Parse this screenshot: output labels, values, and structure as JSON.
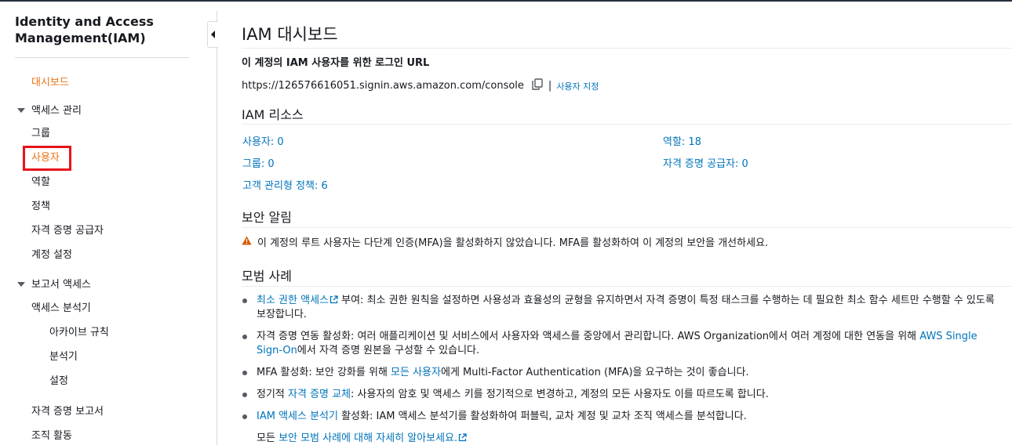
{
  "sidebar": {
    "title": "Identity and Access Management(IAM)",
    "dashboard": "대시보드",
    "access_management": {
      "label": "액세스 관리",
      "items": [
        "그룹",
        "사용자",
        "역할",
        "정책",
        "자격 증명 공급자",
        "계정 설정"
      ]
    },
    "access_reports": {
      "label": "보고서 액세스",
      "analyzer": "액세스 분석기",
      "analyzer_items": [
        "아카이브 규칙",
        "분석기",
        "설정"
      ],
      "items": [
        "자격 증명 보고서",
        "조직 활동"
      ]
    },
    "active_item": "대시보드",
    "highlighted_item": "사용자"
  },
  "main": {
    "title": "IAM 대시보드",
    "signin": {
      "label": "이 계정의 IAM 사용자를 위한 로그인 URL",
      "url": "https://126576616051.signin.aws.amazon.com/console",
      "separator": "|",
      "customize_link": "사용자 지정"
    },
    "resources": {
      "title": "IAM 리소스",
      "users": "사용자: 0",
      "roles": "역할: 18",
      "groups": "그룹: 0",
      "identity_providers": "자격 증명 공급자: 0",
      "customer_managed_policies": "고객 관리형 정책: 6"
    },
    "security_alerts": {
      "title": "보안 알림",
      "message": "이 계정의 루트 사용자는 다단계 인증(MFA)을 활성화하지 않았습니다. MFA를 활성화하여 이 계정의 보안을 개선하세요."
    },
    "best_practices": {
      "title": "모범 사례",
      "items": [
        {
          "link": "최소 권한 액세스",
          "text": " 부여: 최소 권한 원칙을 설정하면 사용성과 효율성의 균형을 유지하면서 자격 증명이 특정 태스크를 수행하는 데 필요한 최소 함수 세트만 수행할 수 있도록 보장합니다."
        },
        {
          "text": "자격 증명 연동 활성화: 여러 애플리케이션 및 서비스에서 사용자와 액세스를 중앙에서 관리합니다. AWS Organization에서 여러 계정에 대한 연동을 위해 ",
          "link": "AWS Single Sign-On",
          "text_after": "에서 자격 증명 원본을 구성할 수 있습니다."
        },
        {
          "text": "MFA 활성화: 보안 강화를 위해 ",
          "link": "모든 사용자",
          "text_after": "에게 Multi-Factor Authentication (MFA)을 요구하는 것이 좋습니다."
        },
        {
          "text": "정기적 ",
          "link": "자격 증명 교체",
          "text_after": ": 사용자의 암호 및 액세스 키를 정기적으로 변경하고, 계정의 모든 사용자도 이를 따르도록 합니다."
        },
        {
          "link": "IAM 액세스 분석기",
          "text_after": " 활성화: IAM 액세스 분석기를 활성화하여 퍼블릭, 교차 계정 및 교차 조직 액세스를 분석합니다."
        }
      ],
      "footer_text": "모든 ",
      "footer_link": "보안 모범 사례에 대해 자세히 알아보세요."
    }
  },
  "colors": {
    "accent_orange": "#ec7211",
    "link_blue": "#0073bb",
    "highlight_red": "#e8131a",
    "warning_orange": "#d45b07"
  },
  "icons": [
    "caret-down-icon",
    "collapse-left-icon",
    "copy-icon",
    "warning-icon",
    "external-link-icon"
  ]
}
